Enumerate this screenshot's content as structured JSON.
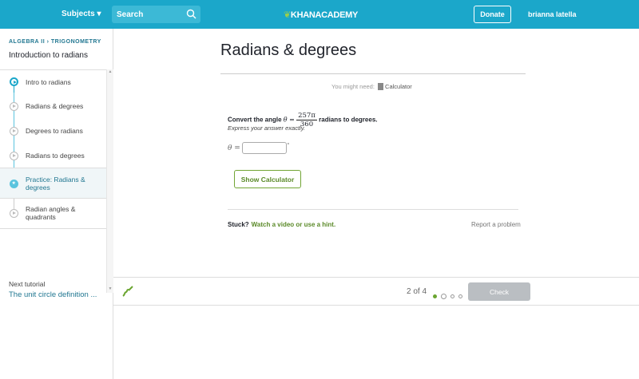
{
  "header": {
    "subjects": "Subjects ▾",
    "search_placeholder": "Search",
    "logo": "KHANACADEMY",
    "donate": "Donate",
    "user": "brianna latella"
  },
  "sidebar": {
    "breadcrumb": "ALGEBRA II  ›  TRIGONOMETRY",
    "title": "Introduction to radians",
    "items": [
      {
        "label": "Intro to radians"
      },
      {
        "label": "Radians & degrees"
      },
      {
        "label": "Degrees to radians"
      },
      {
        "label": "Radians to degrees"
      },
      {
        "label": "Practice: Radians & degrees"
      },
      {
        "label": "Radian angles & quadrants"
      }
    ],
    "next_label": "Next tutorial",
    "next_link": "The unit circle definition ..."
  },
  "main": {
    "title": "Radians & degrees",
    "need": "You might need:",
    "calculator": "Calculator",
    "q_prefix": "Convert the angle ",
    "theta": "θ =",
    "num": "257π",
    "den": "360",
    "q_suffix": " radians to degrees.",
    "hint": "Express your answer exactly.",
    "answer_label": "θ =",
    "answer_value": "",
    "degree": "°",
    "show_calc": "Show Calculator",
    "stuck": "Stuck?",
    "hint_link": "Watch a video or use a hint.",
    "report": "Report a problem"
  },
  "footer": {
    "progress": "2 of 4",
    "check": "Check",
    "current": 2,
    "total": 4
  },
  "colors": {
    "header": "#1ba7ca",
    "accent_green": "#72a535",
    "link_blue": "#217791"
  }
}
